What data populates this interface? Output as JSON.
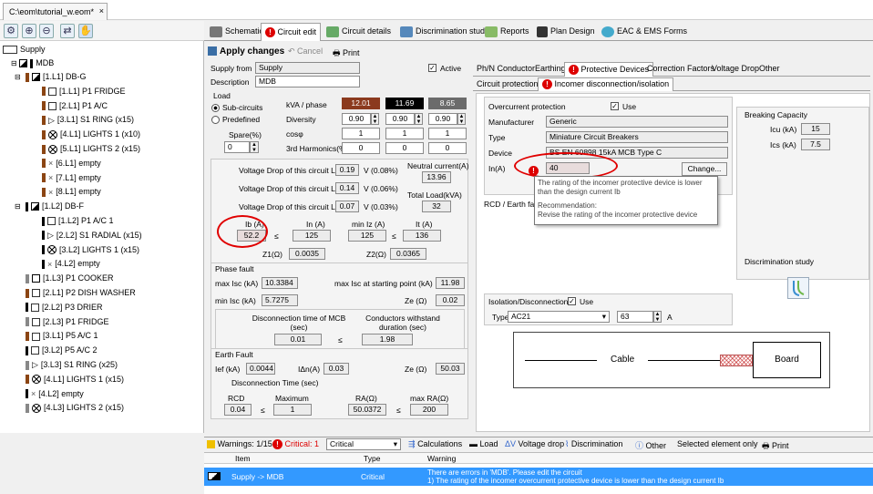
{
  "window": {
    "doc_tab": "C:\\eom\\tutorial_w.eom*",
    "close_glyph": "×"
  },
  "tree": {
    "root": "Supply",
    "items": [
      {
        "label": "MDB",
        "level": 1
      },
      {
        "label": "[1.L1] DB-G",
        "level": 2
      },
      {
        "label": "[1.L1] P1 FRIDGE",
        "level": 3
      },
      {
        "label": "[2.L1] P1 A/C",
        "level": 3
      },
      {
        "label": "[3.L1] S1 RING (x15)",
        "level": 3
      },
      {
        "label": "[4.L1] LIGHTS 1 (x10)",
        "level": 3
      },
      {
        "label": "[5.L1] LIGHTS 2 (x15)",
        "level": 3
      },
      {
        "label": "[6.L1] empty",
        "level": 3
      },
      {
        "label": "[7.L1] empty",
        "level": 3
      },
      {
        "label": "[8.L1] empty",
        "level": 3
      },
      {
        "label": "[1.L2] DB-F",
        "level": 2
      },
      {
        "label": "[1.L2] P1 A/C 1",
        "level": 3
      },
      {
        "label": "[2.L2] S1 RADIAL (x15)",
        "level": 3
      },
      {
        "label": "[3.L2] LIGHTS 1 (x15)",
        "level": 3
      },
      {
        "label": "[4.L2] empty",
        "level": 3
      },
      {
        "label": "[1.L3] P1 COOKER",
        "level": 2
      },
      {
        "label": "[2.L1] P2 DISH WASHER",
        "level": 2
      },
      {
        "label": "[2.L2] P3 DRIER",
        "level": 2
      },
      {
        "label": "[2.L3] P1 FRIDGE",
        "level": 2
      },
      {
        "label": "[3.L1] P5 A/C 1",
        "level": 2
      },
      {
        "label": "[3.L2] P5 A/C 2",
        "level": 2
      },
      {
        "label": "[3.L3] S1 RING (x25)",
        "level": 2
      },
      {
        "label": "[4.L1] LIGHTS 1 (x15)",
        "level": 2
      },
      {
        "label": "[4.L2] empty",
        "level": 2
      },
      {
        "label": "[4.L3] LIGHTS 2 (x15)",
        "level": 2
      }
    ]
  },
  "tabs": [
    "Schematic",
    "Circuit edit",
    "Circuit details",
    "Discrimination study",
    "Reports",
    "Plan Design",
    "EAC & EMS Forms"
  ],
  "toolbar": {
    "apply": "Apply changes",
    "cancel": "Cancel",
    "print": "Print"
  },
  "circuit": {
    "supply_from_label": "Supply from",
    "supply_from": "Supply",
    "description_label": "Description",
    "description": "MDB",
    "active_label": "Active",
    "load_label": "Load",
    "sub_circuits": "Sub-circuits",
    "predefined": "Predefined",
    "spare_label": "Spare(%)",
    "spare": "0",
    "kva_phase_label": "kVA / phase",
    "phase_values": [
      "12.01",
      "11.69",
      "8.65"
    ],
    "phase_colors": [
      "#8b3a1e",
      "#000000",
      "#6b6b6b"
    ],
    "diversity_label": "Diversity",
    "diversity": [
      "0.90",
      "0.90",
      "0.90"
    ],
    "cosphi_label": "cosφ",
    "cosphi": [
      "1",
      "1",
      "1"
    ],
    "harmonics_label": "3rd Harmonics(%)",
    "harmonics": [
      "0",
      "0",
      "0"
    ]
  },
  "vdrop": {
    "l1_label": "Voltage Drop of this circuit L1",
    "l1": "0.19",
    "l1_pct": "V (0.08%)",
    "l2_label": "Voltage Drop of this circuit L2",
    "l2": "0.14",
    "l2_pct": "V (0.06%)",
    "l3_label": "Voltage Drop of this circuit L3",
    "l3": "0.07",
    "l3_pct": "V (0.03%)",
    "neutral_label": "Neutral current(A)",
    "neutral": "13.96",
    "total_label": "Total Load(kVA)",
    "total": "32",
    "ib_label": "Ib (A)",
    "ib": "52.2",
    "in_label": "In (A)",
    "in": "125",
    "miniz_label": "min Iz (A)",
    "miniz": "125",
    "it_label": "It (A)",
    "it": "136",
    "z1_label": "Z1(Ω)",
    "z1": "0.0035",
    "z2_label": "Z2(Ω)",
    "z2": "0.0365",
    "le": "≤"
  },
  "phase_fault": {
    "title": "Phase fault",
    "max_isc_label": "max Isc (kA)",
    "max_isc": "10.3384",
    "max_isc_start_label": "max Isc at starting point (kA)",
    "max_isc_start": "11.98",
    "min_isc_label": "min Isc (kA)",
    "min_isc": "5.7275",
    "ze_label": "Ze (Ω)",
    "ze": "0.02",
    "disc_label": "Disconnection time of MCB (sec)",
    "disc": "0.01",
    "cond_label": "Conductors withstand duration (sec)",
    "cond": "1.98"
  },
  "earth_fault": {
    "title": "Earth Fault",
    "ief_label": "Ief (kA)",
    "ief": "0.0044",
    "idn_label": "IΔn(A)",
    "idn": "0.03",
    "ze_label": "Ze (Ω)",
    "ze": "50.03",
    "disc_time_label": "Disconnection Time (sec)",
    "rcd_label": "RCD",
    "rcd": "0.04",
    "maximum_label": "Maximum",
    "maximum": "1",
    "ra_label": "RA(Ω)",
    "ra": "50.0372",
    "max_ra_label": "max RA(Ω)",
    "max_ra": "200"
  },
  "right_tabs": [
    "Ph/N Conductor",
    "Earthing",
    "Protective Devices",
    "Correction Factors",
    "Voltage Drop",
    "Other"
  ],
  "sub_tabs": [
    "Circuit protection",
    "Incomer disconnection/isolation"
  ],
  "overcurrent": {
    "title": "Overcurrent protection",
    "use_label": "Use",
    "manufacturer_label": "Manufacturer",
    "manufacturer": "Generic",
    "type_label": "Type",
    "type": "Miniature Circuit Breakers",
    "device_label": "Device",
    "device": "BS EN 60898 15kA MCB Type C",
    "in_label": "In(A)",
    "in": "40",
    "change": "Change..."
  },
  "tooltip": {
    "line1": "The rating of the incomer protective device is lower than the design current Ib",
    "rec_title": "Recommendation:",
    "rec": "Revise the rating of the incomer protective device"
  },
  "rcd_partial": "RCD / Earth fa",
  "breaking": {
    "title": "Breaking Capacity",
    "icu_label": "Icu (kA)",
    "icu": "15",
    "ics_label": "Ics (kA)",
    "ics": "7.5"
  },
  "disc_study": "Discrimination study",
  "isolation": {
    "title": "Isolation/Disconnection",
    "use_label": "Use",
    "type_label": "Type",
    "type": "AC21",
    "rating": "63",
    "unit": "A"
  },
  "diagram": {
    "cable": "Cable",
    "board": "Board"
  },
  "bottom": {
    "warnings": "Warnings: 1/15",
    "critical": "Critical: 1",
    "filter": "Critical",
    "calculations": "Calculations",
    "load": "Load",
    "vdrop": "Voltage drop",
    "discrimination": "Discrimination",
    "other": "Other",
    "selected_only": "Selected element only",
    "print": "Print"
  },
  "grid": {
    "headers": [
      "Item",
      "Type",
      "Warning"
    ],
    "row": {
      "item": "Supply -> MDB",
      "type": "Critical",
      "warning1": "There are errors in 'MDB'. Please edit the circuit",
      "warning2": "1) The rating of the incomer overcurrent protective device is lower than the design current Ib"
    }
  }
}
